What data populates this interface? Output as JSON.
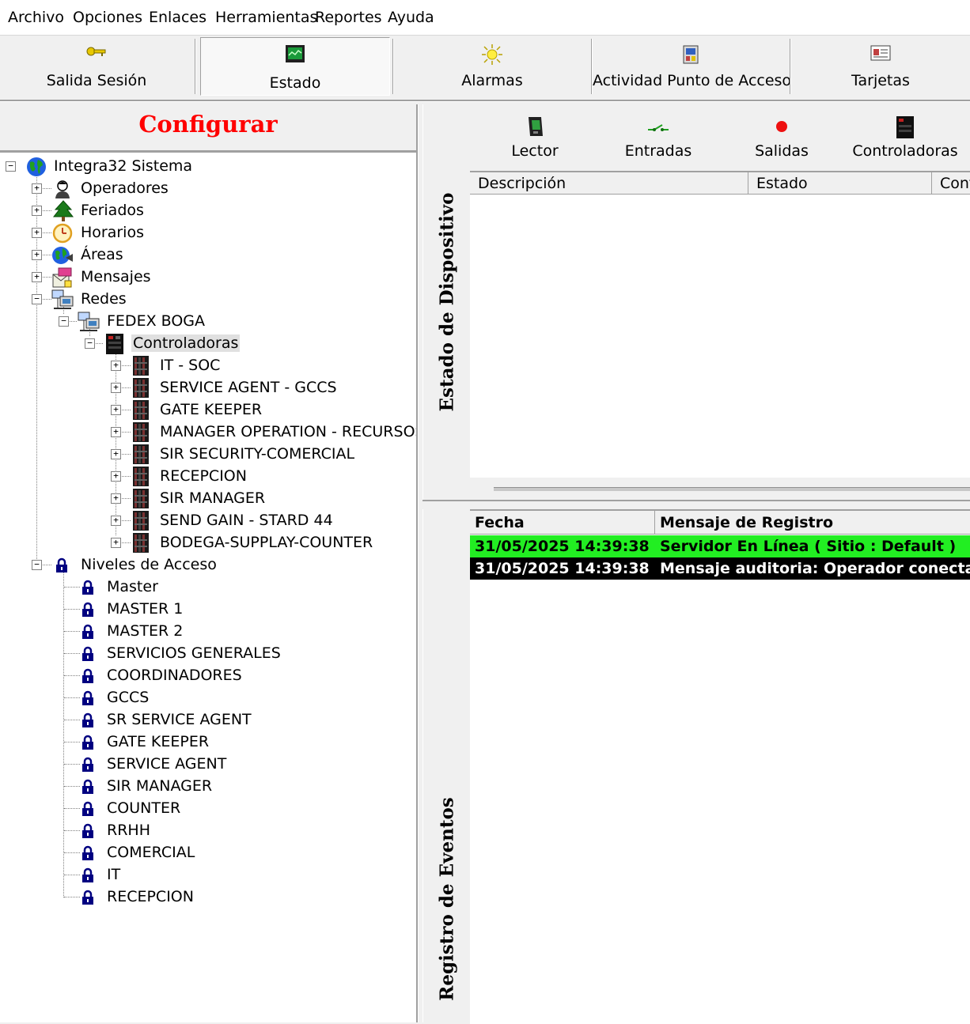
{
  "menu": [
    "Archivo",
    "Opciones",
    "Enlaces",
    "Herramientas",
    "Reportes",
    "Ayuda"
  ],
  "toolbar": {
    "logout": "Salida Sesión",
    "status": "Estado",
    "alarms": "Alarmas",
    "access_activity": "Actividad Punto de Acceso",
    "cards": "Tarjetas"
  },
  "config": {
    "title": "Configurar"
  },
  "tree": {
    "root": "Integra32 Sistema",
    "operators": "Operadores",
    "holidays": "Feriados",
    "schedules": "Horarios",
    "areas": "Áreas",
    "messages": "Mensajes",
    "networks": "Redes",
    "network_name": "FEDEX BOGA",
    "controllers": "Controladoras",
    "controller_items": [
      "IT - SOC",
      "SERVICE AGENT - GCCS",
      "GATE KEEPER",
      "MANAGER OPERATION - RECURSOS",
      "SIR SECURITY-COMERCIAL",
      "RECEPCION",
      "SIR MANAGER",
      "SEND GAIN - STARD 44",
      "BODEGA-SUPPLAY-COUNTER"
    ],
    "access_levels": "Niveles de Acceso",
    "access_level_items": [
      "Master",
      "MASTER 1",
      "MASTER 2",
      "SERVICIOS GENERALES",
      "COORDINADORES",
      "GCCS",
      "SR SERVICE AGENT",
      "GATE KEEPER",
      "SERVICE AGENT",
      "SIR MANAGER",
      "COUNTER",
      "RRHH",
      "COMERCIAL",
      "IT",
      "RECEPCION"
    ]
  },
  "device_status": {
    "title": "Estado de Dispositivo",
    "buttons": {
      "reader": "Lector",
      "inputs": "Entradas",
      "outputs": "Salidas",
      "controllers": "Controladoras"
    },
    "columns": [
      "Descripción",
      "Estado",
      "Controladora"
    ]
  },
  "event_log": {
    "title": "Registro de Eventos",
    "columns": [
      "Fecha",
      "Mensaje de Registro"
    ],
    "rows": [
      {
        "date": "31/05/2025 14:39:38",
        "message": "Servidor En Línea ( Sitio : Default )",
        "bg": "#22ee22",
        "fg": "#000000"
      },
      {
        "date": "31/05/2025 14:39:38",
        "message": "Mensaje auditoria: Operador  conectado",
        "bg": "#000000",
        "fg": "#ffffff"
      }
    ]
  }
}
